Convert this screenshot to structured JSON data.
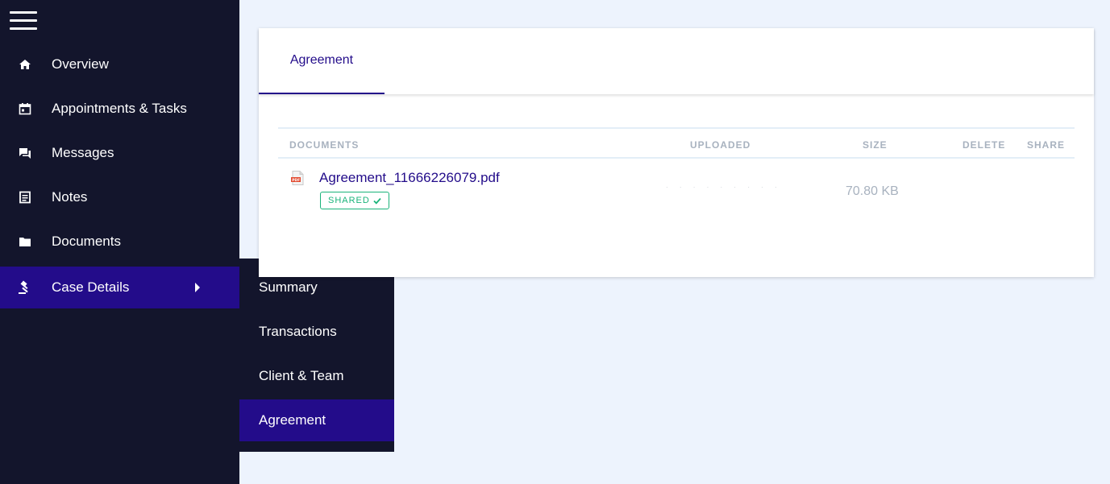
{
  "sidebar": {
    "menu_icon": "hamburger-icon",
    "items": [
      {
        "label": "Overview",
        "icon": "home-icon"
      },
      {
        "label": "Appointments & Tasks",
        "icon": "calendar-icon"
      },
      {
        "label": "Messages",
        "icon": "chat-icon"
      },
      {
        "label": "Notes",
        "icon": "notes-icon"
      },
      {
        "label": "Documents",
        "icon": "folder-icon"
      },
      {
        "label": "Case Details",
        "icon": "gavel-icon",
        "active": true
      }
    ]
  },
  "submenu": {
    "items": [
      {
        "label": "Summary"
      },
      {
        "label": "Transactions"
      },
      {
        "label": "Client & Team"
      },
      {
        "label": "Agreement",
        "active": true
      }
    ]
  },
  "main": {
    "tabs": [
      {
        "label": "Agreement",
        "active": true
      }
    ],
    "table": {
      "columns": [
        "DOCUMENTS",
        "UPLOADED",
        "SIZE",
        "DELETE",
        "SHARE"
      ],
      "rows": [
        {
          "name": "Agreement_11666226079.pdf",
          "icon": "pdf-icon",
          "badge": "SHARED",
          "uploaded": "· · · · · · · · ·",
          "size": "70.80 KB"
        }
      ]
    }
  },
  "colors": {
    "sidebar_bg": "#13152c",
    "accent": "#230c8a",
    "shared": "#1ab37a",
    "page_bg": "#edf3fd"
  }
}
